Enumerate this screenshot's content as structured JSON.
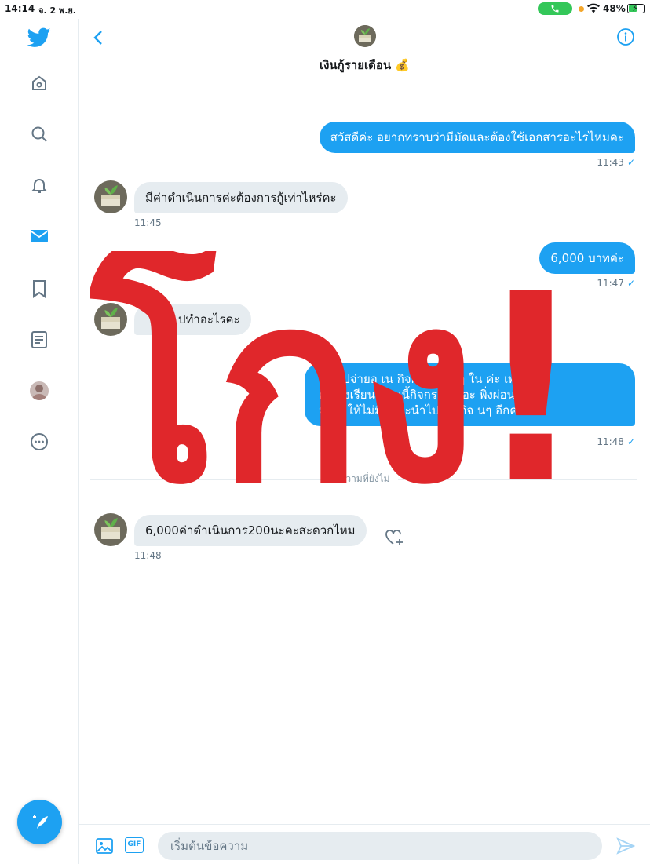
{
  "status_bar": {
    "time": "14:14",
    "date": "จ. 2 พ.ย.",
    "battery": "48%",
    "battery_level": 0.48
  },
  "sidebar": {
    "items": [
      {
        "icon": "twitter-logo-icon"
      },
      {
        "icon": "home-icon"
      },
      {
        "icon": "search-icon"
      },
      {
        "icon": "bell-icon"
      },
      {
        "icon": "mail-icon",
        "active": true
      },
      {
        "icon": "bookmark-icon"
      },
      {
        "icon": "list-icon"
      },
      {
        "icon": "profile-avatar"
      },
      {
        "icon": "more-icon"
      }
    ],
    "compose_icon": "compose-icon"
  },
  "header": {
    "title": "เงินกู้รายเดือน 💰"
  },
  "messages": [
    {
      "dir": "out",
      "text": "สวัสดีค่ะ อยากทราบว่ามีมัดและต้องใช้เอกสารอะไรไหมคะ",
      "time": "11:43"
    },
    {
      "dir": "in",
      "text": "มีค่าดำเนินการค่ะต้องการกู้เท่าไหร่คะ",
      "time": "11:45"
    },
    {
      "dir": "out",
      "text": "6,000 บาทค่ะ",
      "time": "11:47"
    },
    {
      "dir": "in",
      "text": "ปทำอะไรคะ"
    },
    {
      "dir": "out",
      "lines": [
        "เงินไปจ่ายอ    เน    กิจกรรมต่างๆ ใน          ค่ะ เพราะ",
        "ตัวเองเรียนต                อนนี้กิจกรรมเยอะ          พิ่งผ่อนค่า",
        "ม ไป       ให้ไม่มีเ        ที่จะนำไปจ่ายกิจ          นๆ อีกค่ะ"
      ],
      "time": "11:48"
    },
    {
      "dir": "in",
      "text": "6,000ค่าดำเนินการ200นะคะสะดวกไหม",
      "time": "11:48"
    }
  ],
  "unread_label": "ความที่ยังไม่",
  "composer": {
    "placeholder": "เริ่มต้นข้อความ",
    "gif_label": "GIF"
  },
  "stamp": {
    "text": "โกง!",
    "color": "#e0272b"
  },
  "colors": {
    "accent": "#1da1f2",
    "bubble_in": "#e6ecf0",
    "stamp": "#e0272b"
  }
}
